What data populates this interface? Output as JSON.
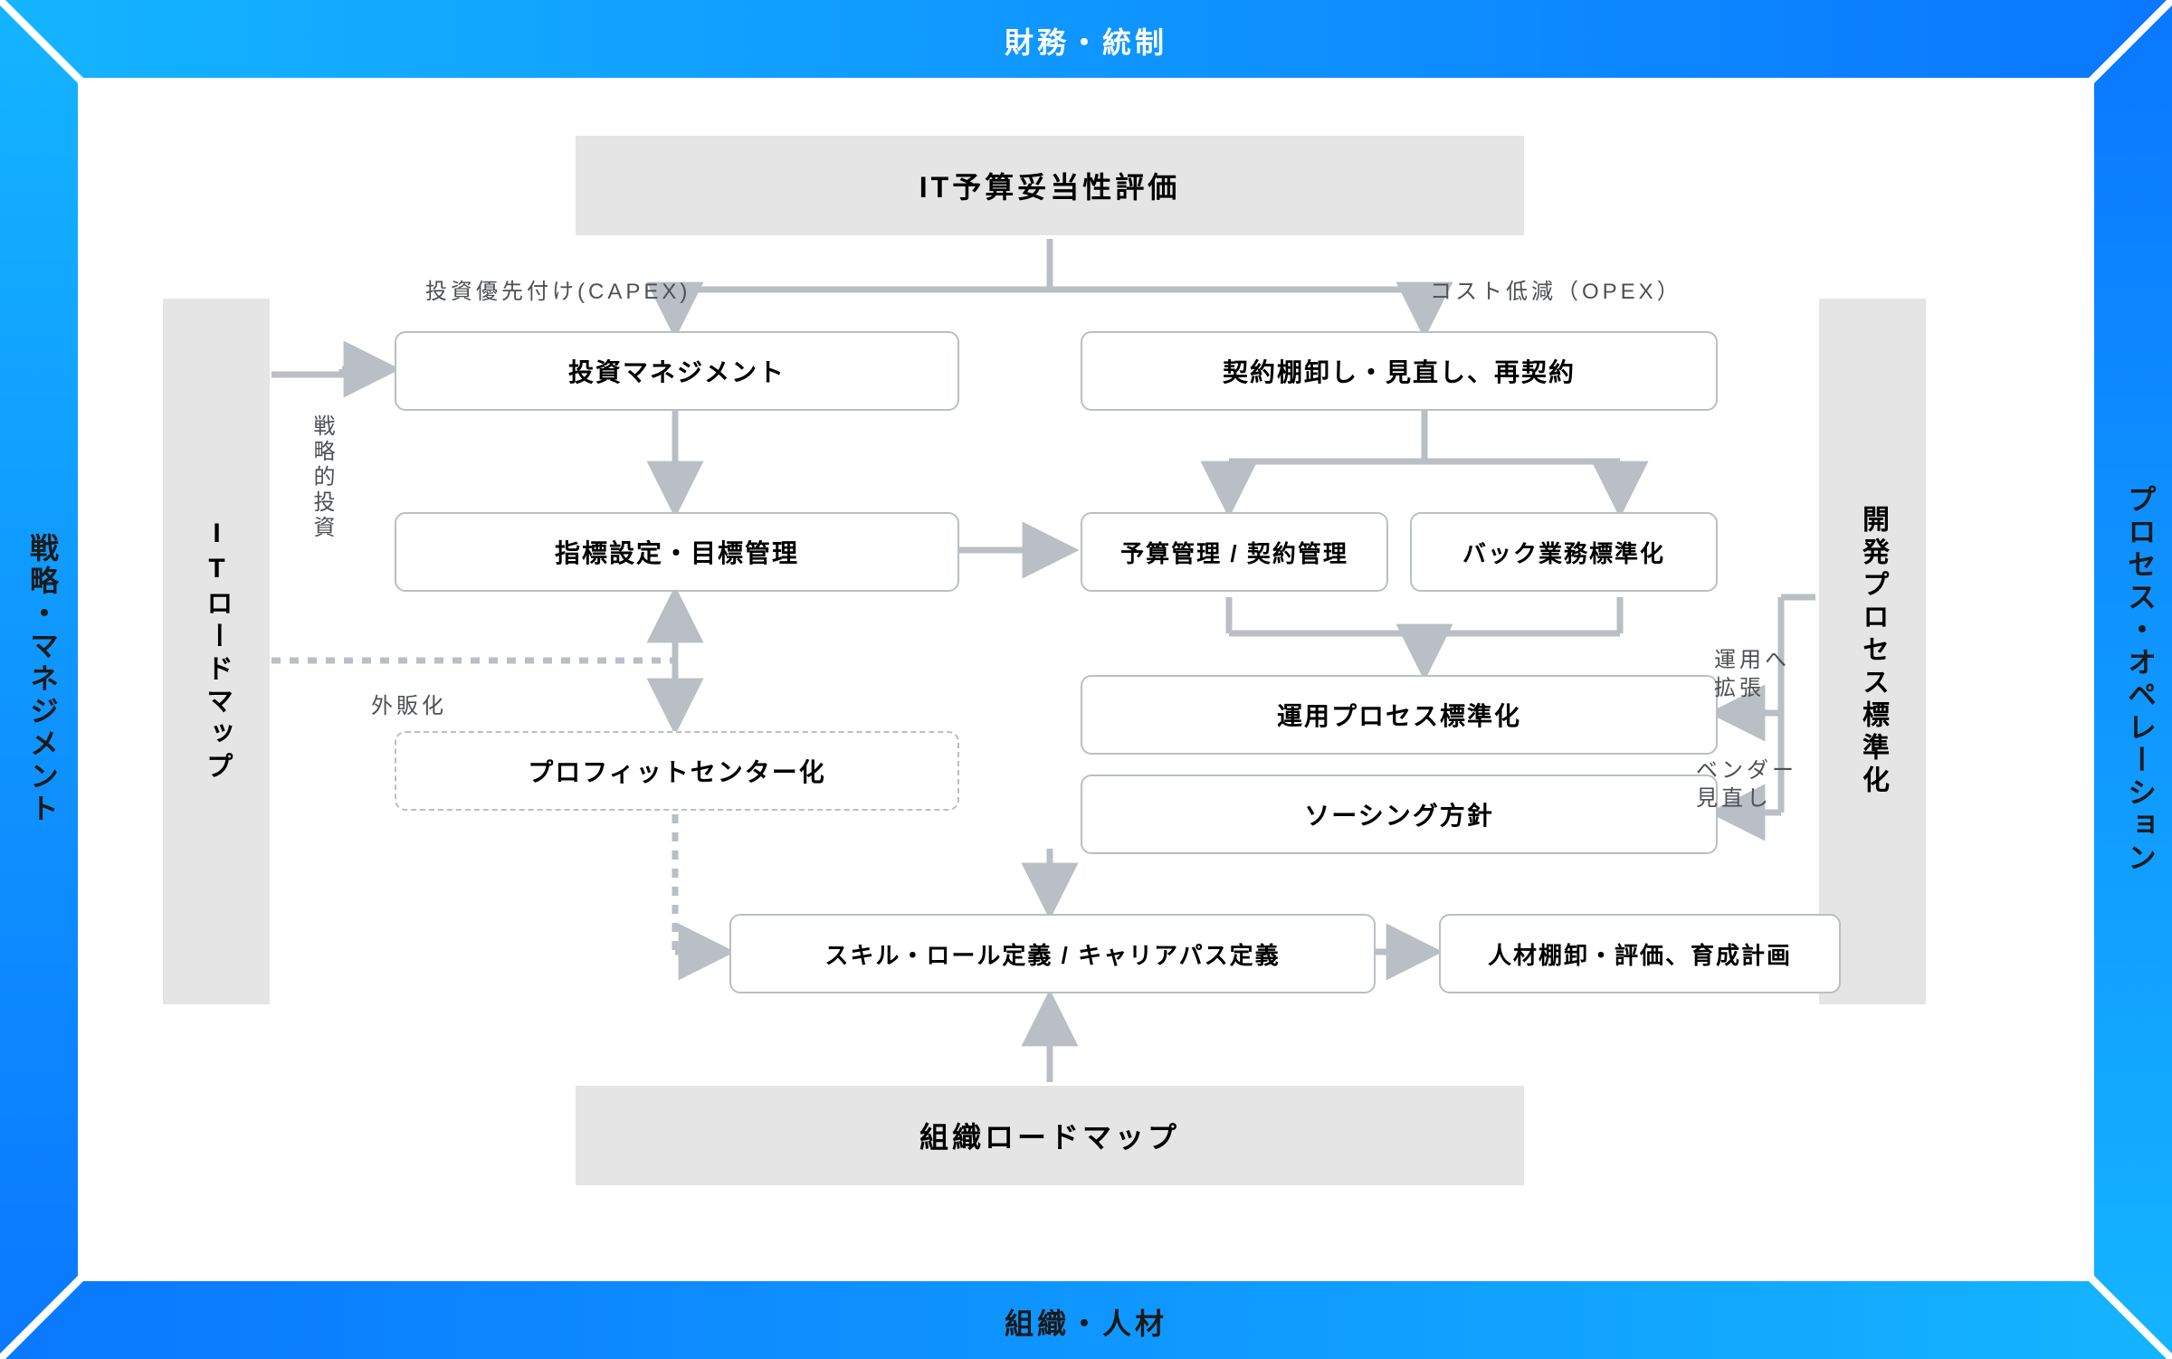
{
  "frame": {
    "top": "財務・統制",
    "bottom": "組織・人材",
    "left": "戦略・マネジメント",
    "right": "プロセス・オペレーション"
  },
  "gray": {
    "top_bar": "IT予算妥当性評価",
    "left_col": "ITロードマップ",
    "right_col": "開発プロセス標準化",
    "bottom_bar": "組織ロードマップ"
  },
  "boxes": {
    "investment_mgmt": "投資マネジメント",
    "contract_review": "契約棚卸し・見直し、再契約",
    "kpi_target": "指標設定・目標管理",
    "budget_contract": "予算管理 / 契約管理",
    "back_office_std": "バック業務標準化",
    "ops_process_std": "運用プロセス標準化",
    "sourcing_policy": "ソーシング方針",
    "profit_center": "プロフィットセンター化",
    "skill_role_career": "スキル・ロール定義 / キャリアパス定義",
    "hr_inventory_plan": "人材棚卸・評価、育成計画"
  },
  "annotations": {
    "capex": "投資優先付け(CAPEX)",
    "opex": "コスト低減（OPEX）",
    "strategic_investment": "戦略的投資",
    "externalize": "外販化",
    "expand_to_ops": "運用へ拡張",
    "vendor_review": "ベンダー見直し"
  },
  "colors": {
    "frame_grad_a": "#14b4ff",
    "frame_grad_b": "#0a78ff",
    "gray": "#e5e5e5",
    "box_border": "#b9bfc4",
    "arrow": "#b9bfc4"
  }
}
